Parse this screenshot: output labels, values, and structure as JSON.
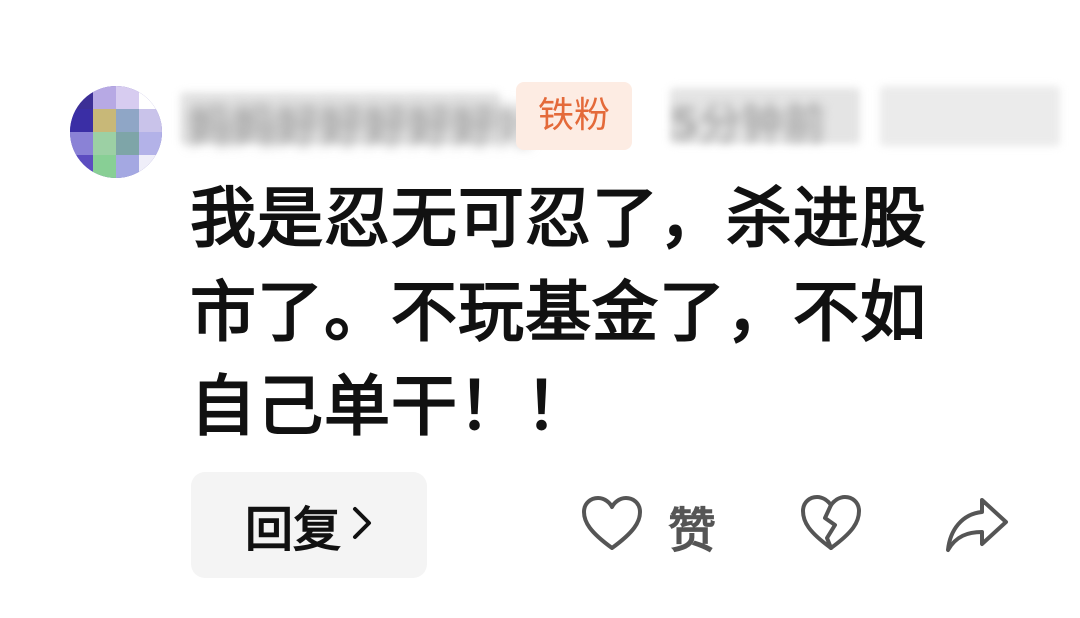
{
  "comment": {
    "author": {
      "name": "妈妈好好好好好好",
      "badge": "铁粉",
      "time": "5分钟前"
    },
    "text": "我是忍无可忍了，杀进股\n市了。不玩基金了，不如\n自己单干！！"
  },
  "actions": {
    "reply_label": "回复",
    "reply_chevron": "›",
    "like_label": "赞",
    "icons": {
      "like": "heart-outline-icon",
      "dislike": "broken-heart-icon",
      "share": "share-arrow-icon",
      "reply": "chevron-right-icon"
    }
  },
  "colors": {
    "badge_bg": "#fdece3",
    "badge_text": "#e46a3a",
    "text_primary": "#111111",
    "icon_gray": "#555555",
    "reply_bg": "#f4f4f4"
  }
}
